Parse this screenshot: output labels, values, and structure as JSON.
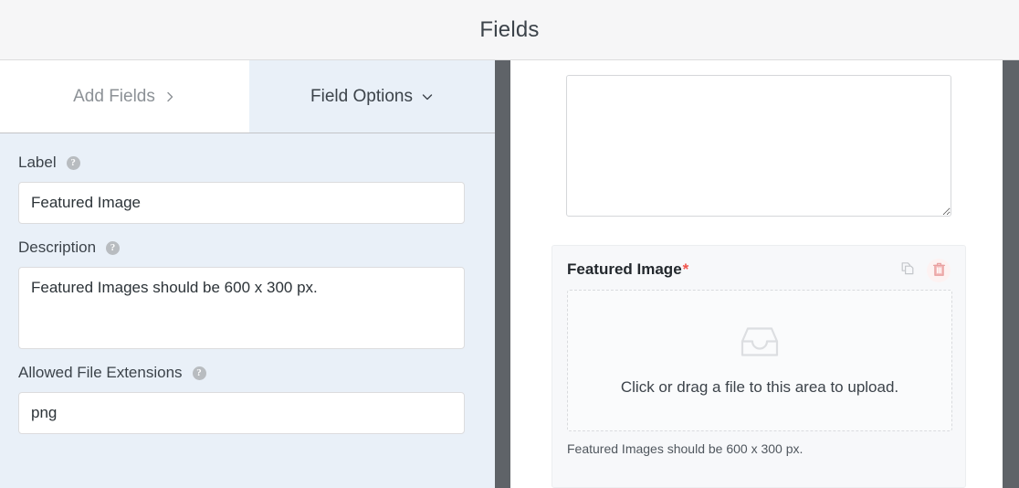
{
  "header": {
    "title": "Fields"
  },
  "tabs": [
    {
      "label": "Add Fields",
      "icon": "chevron-right-icon",
      "active": false
    },
    {
      "label": "Field Options",
      "icon": "chevron-down-icon",
      "active": true
    }
  ],
  "field_options": {
    "label_field": {
      "label": "Label",
      "help_icon": "help-circle-icon",
      "value": "Featured Image",
      "placeholder": ""
    },
    "description_field": {
      "label": "Description",
      "help_icon": "help-circle-icon",
      "value": "Featured Images should be 600 x 300 px.",
      "placeholder": ""
    },
    "extensions_field": {
      "label": "Allowed File Extensions",
      "help_icon": "help-circle-icon",
      "value": "png",
      "placeholder": ""
    }
  },
  "preview": {
    "textarea": {
      "value": "",
      "placeholder": ""
    },
    "upload_field": {
      "title": "Featured Image",
      "required_marker": "*",
      "dropzone_text": "Click or drag a file to this area to upload.",
      "dropzone_icon": "inbox-tray-icon",
      "hint": "Featured Images should be 600 x 300 px.",
      "actions": [
        {
          "name": "duplicate-field-button",
          "icon": "duplicate-icon"
        },
        {
          "name": "delete-field-button",
          "icon": "trash-icon"
        }
      ]
    }
  },
  "colors": {
    "header_bg": "#f6f6f7",
    "panel_bg": "#e9f0f8",
    "divider": "#5f6368",
    "required": "#f0544c",
    "trash": "#e8a0a0",
    "text": "#3c434a"
  }
}
